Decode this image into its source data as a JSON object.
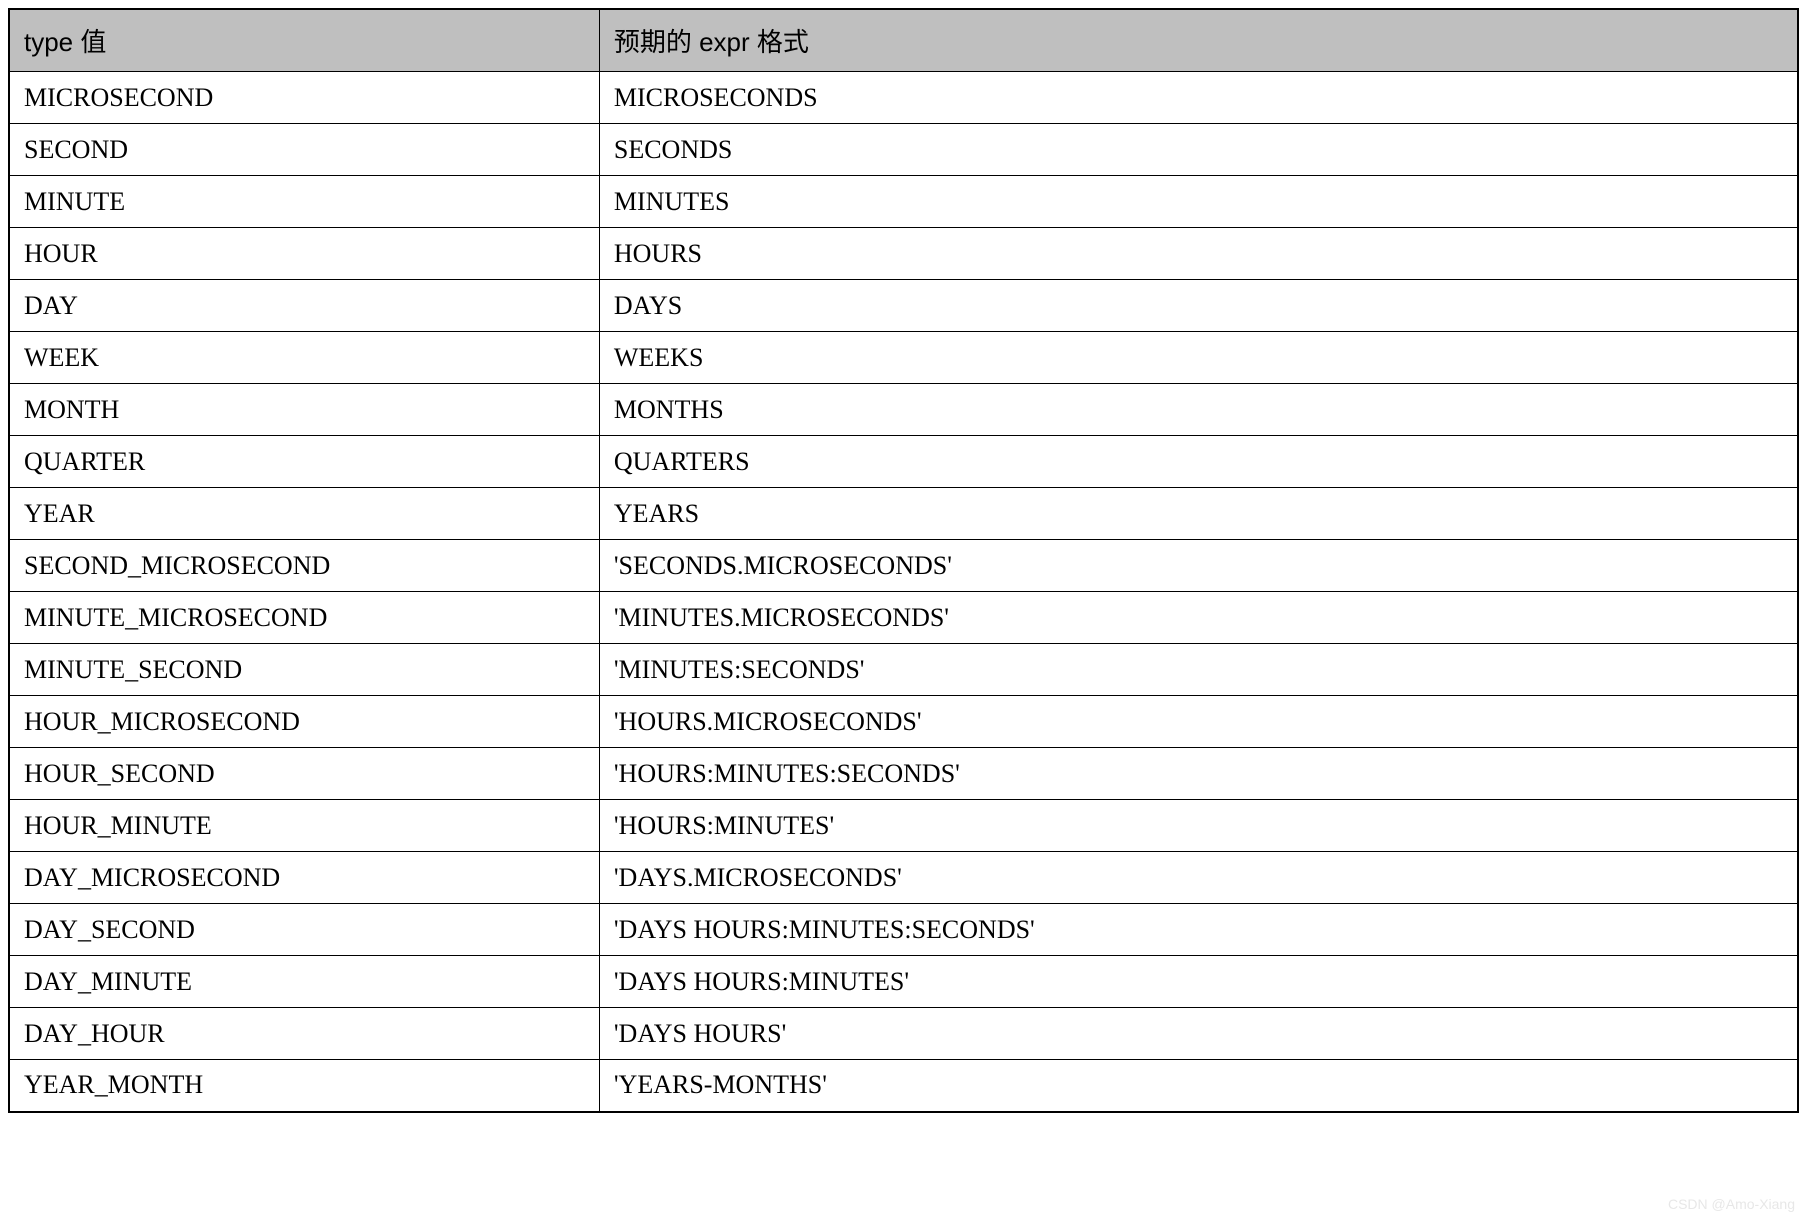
{
  "table": {
    "headers": {
      "col1": "type 值",
      "col2": "预期的 expr 格式"
    },
    "rows": [
      {
        "type": "MICROSECOND",
        "expr": "MICROSECONDS"
      },
      {
        "type": "SECOND",
        "expr": "SECONDS"
      },
      {
        "type": "MINUTE",
        "expr": "MINUTES"
      },
      {
        "type": "HOUR",
        "expr": "HOURS"
      },
      {
        "type": "DAY",
        "expr": "DAYS"
      },
      {
        "type": "WEEK",
        "expr": "WEEKS"
      },
      {
        "type": "MONTH",
        "expr": "MONTHS"
      },
      {
        "type": "QUARTER",
        "expr": "QUARTERS"
      },
      {
        "type": "YEAR",
        "expr": "YEARS"
      },
      {
        "type": "SECOND_MICROSECOND",
        "expr": "'SECONDS.MICROSECONDS'"
      },
      {
        "type": "MINUTE_MICROSECOND",
        "expr": "'MINUTES.MICROSECONDS'"
      },
      {
        "type": "MINUTE_SECOND",
        "expr": "'MINUTES:SECONDS'"
      },
      {
        "type": "HOUR_MICROSECOND",
        "expr": "'HOURS.MICROSECONDS'"
      },
      {
        "type": "HOUR_SECOND",
        "expr": "'HOURS:MINUTES:SECONDS'"
      },
      {
        "type": "HOUR_MINUTE",
        "expr": "'HOURS:MINUTES'"
      },
      {
        "type": "DAY_MICROSECOND",
        "expr": "'DAYS.MICROSECONDS'"
      },
      {
        "type": "DAY_SECOND",
        "expr": "'DAYS HOURS:MINUTES:SECONDS'"
      },
      {
        "type": "DAY_MINUTE",
        "expr": "'DAYS HOURS:MINUTES'"
      },
      {
        "type": "DAY_HOUR",
        "expr": "'DAYS HOURS'"
      },
      {
        "type": "YEAR_MONTH",
        "expr": "'YEARS-MONTHS'"
      }
    ]
  },
  "watermark": "CSDN @Amo-Xiang"
}
